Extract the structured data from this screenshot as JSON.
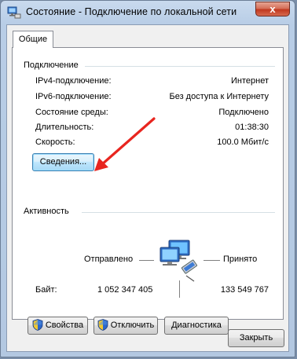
{
  "window": {
    "title": "Состояние - Подключение по локальной сети",
    "close_symbol": "x"
  },
  "tabs": [
    {
      "label": "Общие",
      "active": true
    }
  ],
  "connection": {
    "group_label": "Подключение",
    "rows": [
      {
        "label": "IPv4-подключение:",
        "value": "Интернет"
      },
      {
        "label": "IPv6-подключение:",
        "value": "Без доступа к Интернету"
      },
      {
        "label": "Состояние среды:",
        "value": "Подключено"
      },
      {
        "label": "Длительность:",
        "value": "01:38:30"
      },
      {
        "label": "Скорость:",
        "value": "100.0 Мбит/с"
      }
    ],
    "details_button": "Сведения..."
  },
  "activity": {
    "group_label": "Активность",
    "sent_label": "Отправлено",
    "received_label": "Принято",
    "bytes_label": "Байт:",
    "bytes_sent": "1 052 347 405",
    "bytes_received": "133 549 767"
  },
  "actions": {
    "properties": "Свойства",
    "disable": "Отключить",
    "diagnose": "Диагностика",
    "close": "Закрыть"
  },
  "icons": {
    "title": "network-icon",
    "shield": "uac-shield-icon",
    "activity": "network-computers-icon",
    "annotation": "red-arrow"
  },
  "colors": {
    "arrow": "#e8251f",
    "focus_border": "#3c7fb1"
  }
}
